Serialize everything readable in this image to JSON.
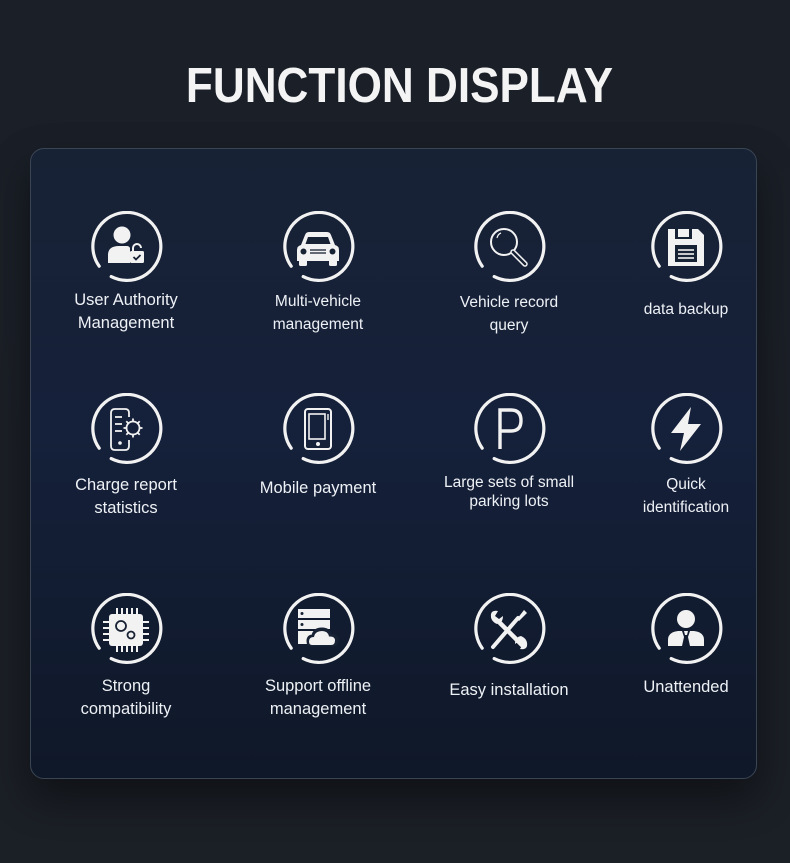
{
  "page": {
    "title": "FUNCTION DISPLAY"
  },
  "features": [
    {
      "icon": "user-lock-icon",
      "line1": "User Authority",
      "line2": "Management"
    },
    {
      "icon": "car-icon",
      "line1": "Multi-vehicle",
      "line2": "management"
    },
    {
      "icon": "search-icon",
      "line1": "Vehicle record",
      "line2": "query"
    },
    {
      "icon": "floppy-disk-icon",
      "line1": "data backup",
      "line2": ""
    },
    {
      "icon": "report-gear-icon",
      "line1": "Charge report",
      "line2": "statistics"
    },
    {
      "icon": "tablet-icon",
      "line1": "Mobile payment",
      "line2": ""
    },
    {
      "icon": "parking-icon",
      "line1": "Large sets of small",
      "line2": "parking lots"
    },
    {
      "icon": "lightning-icon",
      "line1": "Quick",
      "line2": "identification"
    },
    {
      "icon": "chip-gear-icon",
      "line1": "Strong",
      "line2": "compatibility"
    },
    {
      "icon": "server-cloud-icon",
      "line1": "Support offline",
      "line2": "management"
    },
    {
      "icon": "tools-icon",
      "line1": "Easy installation",
      "line2": ""
    },
    {
      "icon": "person-icon",
      "line1": "Unattended",
      "line2": ""
    }
  ],
  "colors": {
    "background": "#1b1f26",
    "card": "#15203a",
    "icon": "#f2f2f2",
    "text": "#eef1f5"
  }
}
